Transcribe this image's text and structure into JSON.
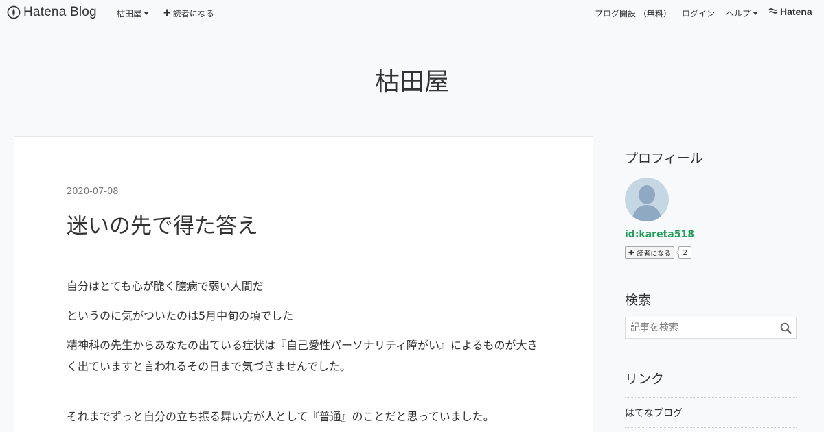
{
  "global_header": {
    "logo_text": "Hatena Blog",
    "blog_menu": "枯田屋",
    "subscribe": "読者になる",
    "open_blog": "ブログ開設 （無料）",
    "login": "ログイン",
    "help": "ヘルプ",
    "hatena": "Hatena"
  },
  "blog": {
    "title": "枯田屋"
  },
  "entry": {
    "date": "2020-07-08",
    "title": "迷いの先で得た答え",
    "paragraphs": [
      "自分はとても心が脆く臆病で弱い人間だ",
      "というのに気がついたのは5月中旬の頃でした",
      "精神科の先生からあなたの出ている症状は『自己愛性パーソナリティ障がい』によるものが大きく出ていますと言われるその日まで気づきませんでした。",
      "それまでずっと自分の立ち振る舞い方が人として『普通』のことだと思っていました。"
    ]
  },
  "sidebar": {
    "profile_heading": "プロフィール",
    "profile_id": "id:kareta518",
    "follow_label": "読者になる",
    "follow_count": "2",
    "search_heading": "検索",
    "search_placeholder": "記事を検索",
    "link_heading": "リンク",
    "links": [
      "はてなブログ"
    ]
  },
  "colors": {
    "background": "#f8f9fa",
    "card": "#ffffff",
    "text": "#333333",
    "profile_link": "#1f9e55"
  }
}
